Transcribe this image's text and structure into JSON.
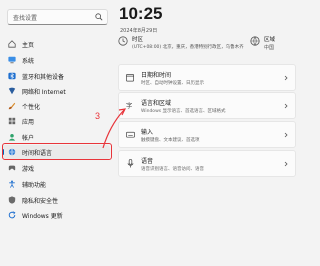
{
  "search": {
    "placeholder": "查找设置"
  },
  "nav": {
    "items": [
      {
        "label": "主页",
        "icon": "home-icon"
      },
      {
        "label": "系统",
        "icon": "monitor-icon"
      },
      {
        "label": "蓝牙和其他设备",
        "icon": "bluetooth-icon"
      },
      {
        "label": "网络和 Internet",
        "icon": "network-icon"
      },
      {
        "label": "个性化",
        "icon": "brush-icon"
      },
      {
        "label": "应用",
        "icon": "apps-icon"
      },
      {
        "label": "帐户",
        "icon": "account-icon"
      },
      {
        "label": "时间和语言",
        "icon": "globe-clock-icon",
        "selected": true
      },
      {
        "label": "游戏",
        "icon": "gamepad-icon"
      },
      {
        "label": "辅助功能",
        "icon": "accessibility-icon"
      },
      {
        "label": "隐私和安全性",
        "icon": "shield-icon"
      },
      {
        "label": "Windows 更新",
        "icon": "update-icon"
      }
    ]
  },
  "annotation": {
    "number": "3",
    "color": "#e8343a"
  },
  "header": {
    "time": "10:25",
    "date": "2024年8月29日",
    "timezone_title": "时区",
    "timezone_value": "(UTC+08:00) 北京，重庆，香港特别行政区，乌鲁木齐",
    "region_title": "区域",
    "region_value": "中国"
  },
  "cards": [
    {
      "title": "日期和时间",
      "subtitle": "时区、自动时钟设置、日历显示",
      "icon": "calendar-clock-icon"
    },
    {
      "title": "语言和区域",
      "subtitle": "Windows 显示语言、首选语言、区域格式",
      "icon": "language-icon"
    },
    {
      "title": "输入",
      "subtitle": "触摸键盘、文本建议、首选项",
      "icon": "keyboard-icon"
    },
    {
      "title": "语音",
      "subtitle": "语音识别语言、语音访问、语音",
      "icon": "microphone-icon"
    }
  ],
  "colors": {
    "accent": "#0067c0",
    "annotation_red": "#e8343a",
    "background": "#f3f3f3"
  }
}
